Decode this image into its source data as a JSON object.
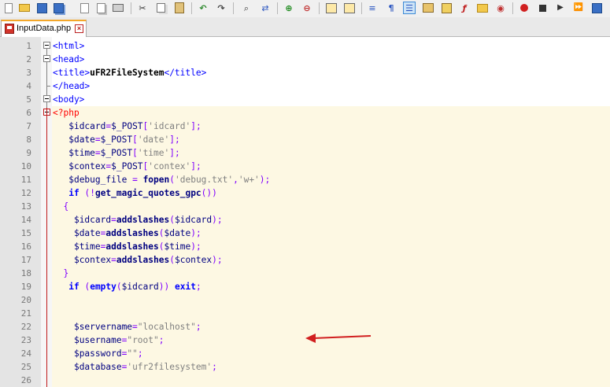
{
  "tab": {
    "file_name": "InputData.php"
  },
  "colors": {
    "php_background": "#fdf8e3",
    "tab_accent": "#f4a72a",
    "arrow": "#d11f1f"
  },
  "toolbar_icons": [
    "new-file-icon",
    "open-file-icon",
    "save-icon",
    "save-all-icon",
    "close-icon",
    "close-all-icon",
    "print-icon",
    "cut-icon",
    "copy-icon",
    "paste-icon",
    "undo-icon",
    "redo-icon",
    "find-icon",
    "replace-icon",
    "zoom-in-icon",
    "zoom-out-icon",
    "sync-vertical-icon",
    "sync-horizontal-icon",
    "word-wrap-icon",
    "show-all-chars-icon",
    "indent-guide-icon",
    "udl-icon",
    "doc-map-icon",
    "function-list-icon",
    "folder-workspace-icon",
    "monitor-icon",
    "record-macro-icon",
    "stop-macro-icon",
    "play-macro-icon",
    "run-macro-multiple-icon",
    "save-macro-icon"
  ],
  "lines": [
    {
      "n": "1",
      "code": "<html>"
    },
    {
      "n": "2",
      "code": "<head>"
    },
    {
      "n": "3",
      "code": "<title>uFR2FileSystem</title>"
    },
    {
      "n": "4",
      "code": "</head>"
    },
    {
      "n": "5",
      "code": "<body>"
    },
    {
      "n": "6",
      "code": "<?php"
    },
    {
      "n": "7",
      "code": "   $idcard=$_POST['idcard'];"
    },
    {
      "n": "8",
      "code": "   $date=$_POST['date'];"
    },
    {
      "n": "9",
      "code": "   $time=$_POST['time'];"
    },
    {
      "n": "10",
      "code": "   $contex=$_POST['contex'];"
    },
    {
      "n": "11",
      "code": "   $debug_file = fopen('debug.txt','w+');"
    },
    {
      "n": "12",
      "code": "   if (!get_magic_quotes_gpc())"
    },
    {
      "n": "13",
      "code": "  {"
    },
    {
      "n": "14",
      "code": "    $idcard=addslashes($idcard);"
    },
    {
      "n": "15",
      "code": "    $date=addslashes($date);"
    },
    {
      "n": "16",
      "code": "    $time=addslashes($time);"
    },
    {
      "n": "17",
      "code": "    $contex=addslashes($contex);"
    },
    {
      "n": "18",
      "code": "  }"
    },
    {
      "n": "19",
      "code": "   if (empty($idcard)) exit;"
    },
    {
      "n": "20",
      "code": ""
    },
    {
      "n": "21",
      "code": ""
    },
    {
      "n": "22",
      "code": "    $servername=\"localhost\";"
    },
    {
      "n": "23",
      "code": "    $username=\"root\";"
    },
    {
      "n": "24",
      "code": "    $password=\"\";"
    },
    {
      "n": "25",
      "code": "    $database='ufr2filesystem';"
    },
    {
      "n": "26",
      "code": ""
    }
  ]
}
